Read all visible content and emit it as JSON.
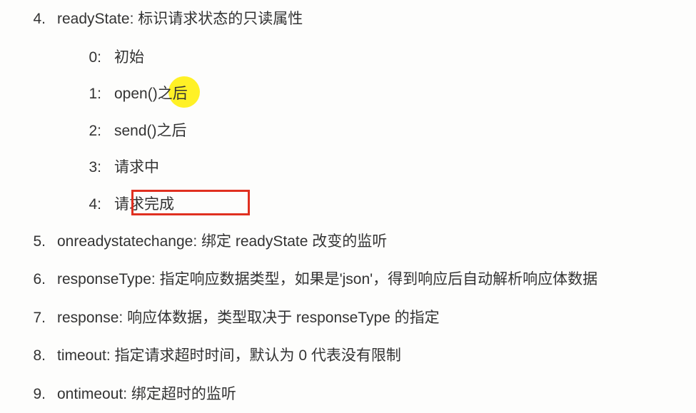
{
  "items": [
    {
      "num": "4.",
      "label": "readyState:",
      "desc": "标识请求状态的只读属性",
      "sub": [
        {
          "num": "0:",
          "text": "初始"
        },
        {
          "num": "1:",
          "text": "open()之后",
          "highlight": true
        },
        {
          "num": "2:",
          "text": "send()之后"
        },
        {
          "num": "3:",
          "text": "请求中"
        },
        {
          "num": "4:",
          "text": "请求完成",
          "boxed": true
        }
      ]
    },
    {
      "num": "5.",
      "label": "onreadystatechange:",
      "desc": "绑定 readyState 改变的监听"
    },
    {
      "num": "6.",
      "label": "responseType:",
      "desc": "指定响应数据类型，如果是'json'，得到响应后自动解析响应体数据"
    },
    {
      "num": "7.",
      "label": "response:",
      "desc": "响应体数据，类型取决于 responseType 的指定"
    },
    {
      "num": "8.",
      "label": "timeout:",
      "desc": "指定请求超时时间，默认为 0 代表没有限制"
    },
    {
      "num": "9.",
      "label": "ontimeout:",
      "desc": "绑定超时的监听"
    }
  ]
}
